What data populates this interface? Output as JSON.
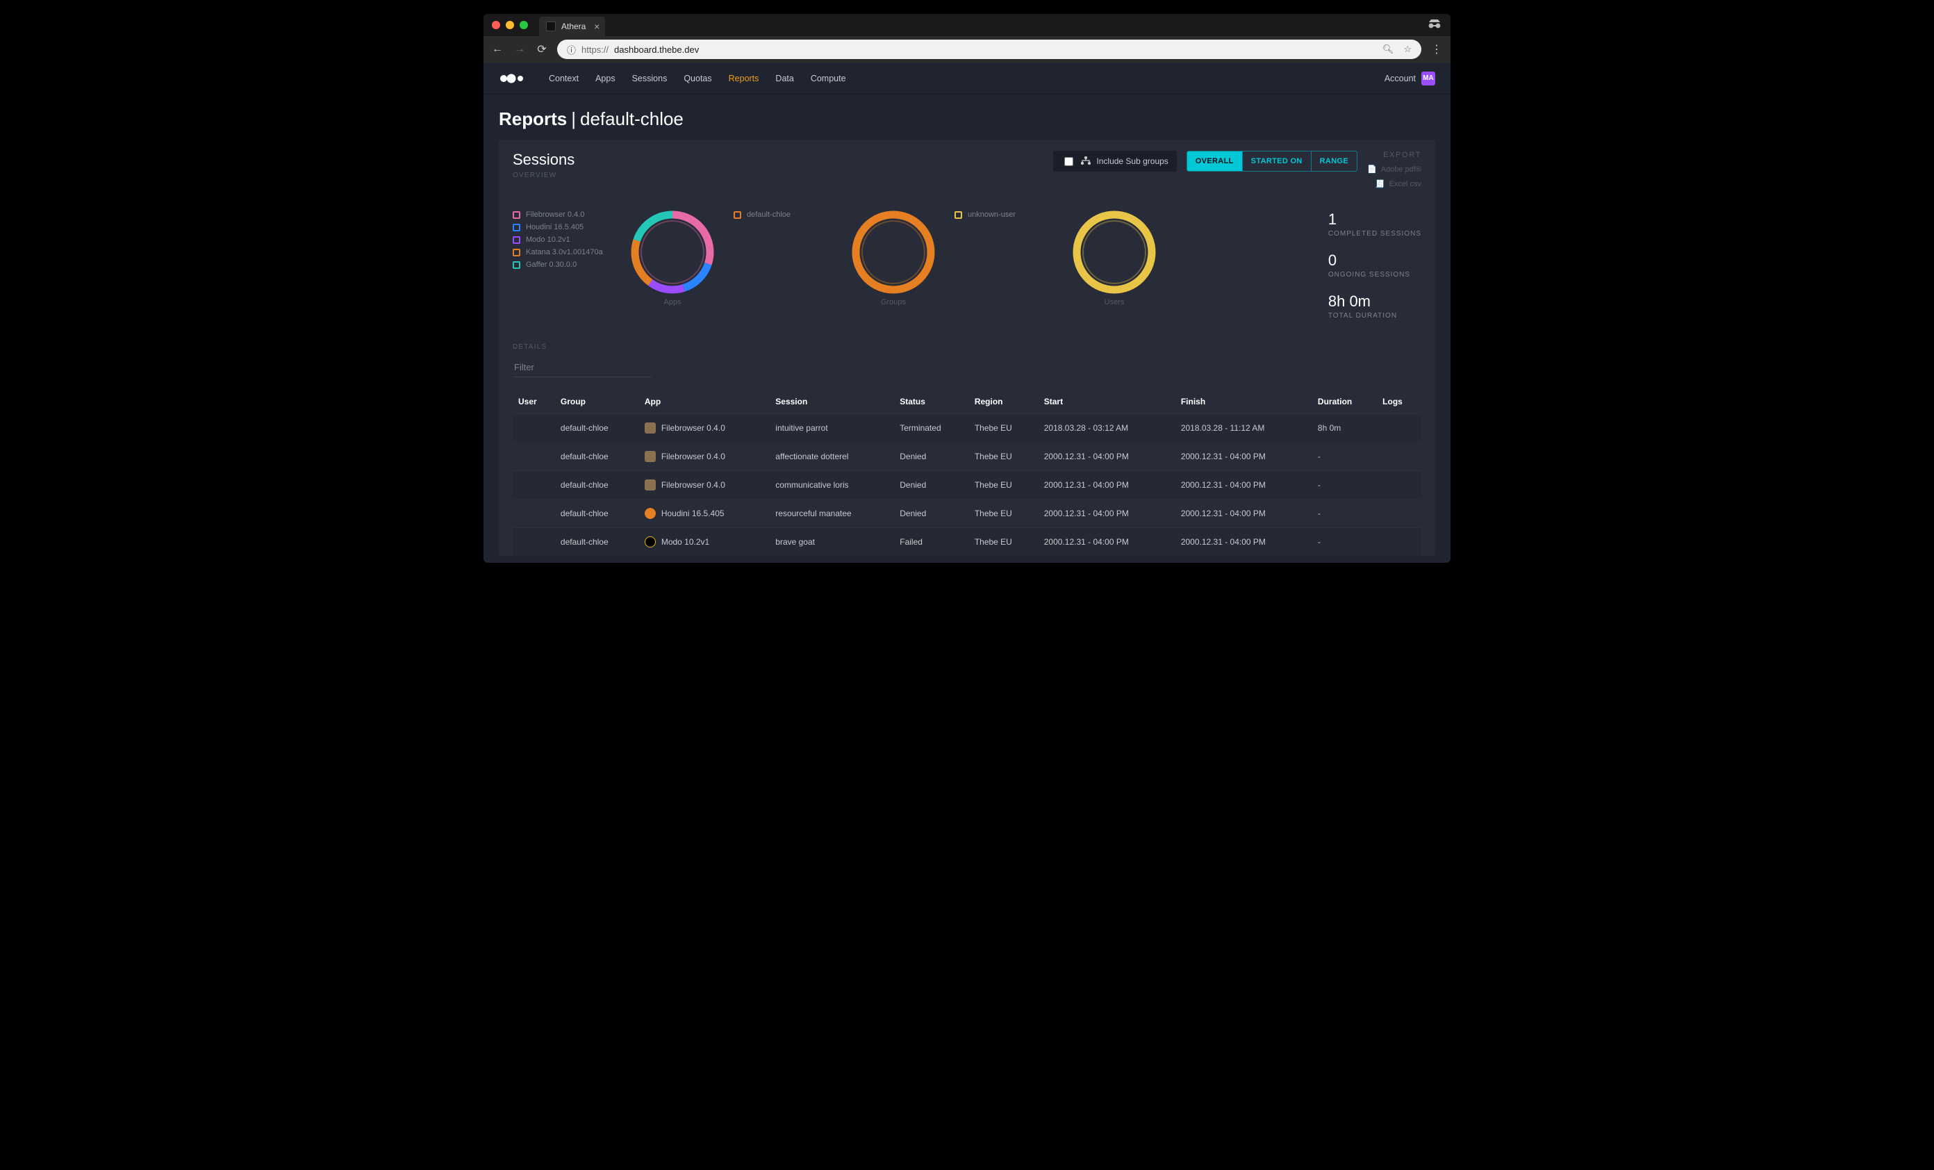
{
  "browser": {
    "tab_title": "Athera",
    "url_prefix": "https://",
    "url_host": "dashboard.thebe.dev"
  },
  "nav": {
    "items": [
      "Context",
      "Apps",
      "Sessions",
      "Quotas",
      "Reports",
      "Data",
      "Compute"
    ],
    "active_index": 4,
    "account_label": "Account",
    "avatar_initials": "MA"
  },
  "page_title": {
    "main": "Reports",
    "scope": "default-chloe"
  },
  "sessions_panel": {
    "title": "Sessions",
    "subhead": "OVERVIEW",
    "include_subgroups_label": "Include Sub groups",
    "include_subgroups_checked": false,
    "segments": [
      "OVERALL",
      "STARTED ON",
      "RANGE"
    ],
    "segment_active": 0,
    "export": {
      "head": "EXPORT",
      "pdf": "Adobe pdf®",
      "excel": "Excel csv"
    }
  },
  "stats": {
    "completed_value": "1",
    "completed_label": "COMPLETED SESSIONS",
    "ongoing_value": "0",
    "ongoing_label": "ONGOING SESSIONS",
    "duration_value": "8h 0m",
    "duration_label": "TOTAL DURATION"
  },
  "chart_data": [
    {
      "type": "pie",
      "title": "Apps",
      "series": [
        {
          "name": "Filebrowser 0.4.0",
          "value": 30,
          "color": "#e86aa6"
        },
        {
          "name": "Houdini 16.5.405",
          "value": 15,
          "color": "#2a84ff"
        },
        {
          "name": "Modo 10.2v1",
          "value": 15,
          "color": "#9b4dff"
        },
        {
          "name": "Katana 3.0v1.001470a",
          "value": 20,
          "color": "#e67e22"
        },
        {
          "name": "Gaffer 0.30.0.0",
          "value": 20,
          "color": "#25c7b7"
        }
      ]
    },
    {
      "type": "pie",
      "title": "Groups",
      "series": [
        {
          "name": "default-chloe",
          "value": 100,
          "color": "#e67e22"
        }
      ]
    },
    {
      "type": "pie",
      "title": "Users",
      "series": [
        {
          "name": "unknown-user",
          "value": 100,
          "color": "#e8c547"
        }
      ]
    }
  ],
  "details": {
    "subhead": "DETAILS",
    "filter_placeholder": "Filter",
    "columns": [
      "User",
      "Group",
      "App",
      "Session",
      "Status",
      "Region",
      "Start",
      "Finish",
      "Duration",
      "Logs"
    ],
    "rows": [
      {
        "user": "",
        "group": "default-chloe",
        "app": "Filebrowser 0.4.0",
        "app_icon": "folder",
        "session": "intuitive parrot",
        "status": "Terminated",
        "region": "Thebe EU",
        "start": "2018.03.28 - 03:12 AM",
        "finish": "2018.03.28 - 11:12 AM",
        "duration": "8h 0m",
        "logs": ""
      },
      {
        "user": "",
        "group": "default-chloe",
        "app": "Filebrowser 0.4.0",
        "app_icon": "folder",
        "session": "affectionate dotterel",
        "status": "Denied",
        "region": "Thebe EU",
        "start": "2000.12.31 - 04:00 PM",
        "finish": "2000.12.31 - 04:00 PM",
        "duration": "-",
        "logs": ""
      },
      {
        "user": "",
        "group": "default-chloe",
        "app": "Filebrowser 0.4.0",
        "app_icon": "folder",
        "session": "communicative loris",
        "status": "Denied",
        "region": "Thebe EU",
        "start": "2000.12.31 - 04:00 PM",
        "finish": "2000.12.31 - 04:00 PM",
        "duration": "-",
        "logs": ""
      },
      {
        "user": "",
        "group": "default-chloe",
        "app": "Houdini 16.5.405",
        "app_icon": "houdini",
        "session": "resourceful manatee",
        "status": "Denied",
        "region": "Thebe EU",
        "start": "2000.12.31 - 04:00 PM",
        "finish": "2000.12.31 - 04:00 PM",
        "duration": "-",
        "logs": ""
      },
      {
        "user": "",
        "group": "default-chloe",
        "app": "Modo 10.2v1",
        "app_icon": "modo",
        "session": "brave goat",
        "status": "Failed",
        "region": "Thebe EU",
        "start": "2000.12.31 - 04:00 PM",
        "finish": "2000.12.31 - 04:00 PM",
        "duration": "-",
        "logs": ""
      }
    ]
  }
}
